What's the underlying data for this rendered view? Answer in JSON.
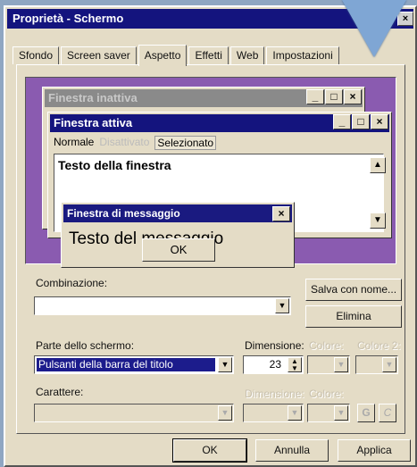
{
  "window": {
    "title": "Proprietà - Schermo",
    "close_glyph": "×"
  },
  "tabs": [
    {
      "label": "Sfondo"
    },
    {
      "label": "Screen saver"
    },
    {
      "label": "Aspetto",
      "active": true
    },
    {
      "label": "Effetti"
    },
    {
      "label": "Web"
    },
    {
      "label": "Impostazioni"
    }
  ],
  "preview": {
    "inactive_title": "Finestra inattiva",
    "active_title": "Finestra attiva",
    "menu_normal": "Normale",
    "menu_disabled": "Disattivato",
    "menu_selected": "Selezionato",
    "window_text": "Testo della finestra",
    "msg_title": "Finestra di messaggio",
    "msg_text": "Testo del messaggio",
    "msg_ok": "OK",
    "cap_min": "_",
    "cap_max": "□",
    "cap_close": "×"
  },
  "form": {
    "scheme_label": "Combinazione:",
    "scheme_value": "",
    "save_as": "Salva con nome...",
    "delete": "Elimina",
    "item_label": "Parte dello schermo:",
    "item_value": "Pulsanti della barra del titolo",
    "size_label": "Dimensione:",
    "size_value": "23",
    "color_label": "Colore:",
    "color2_label": "Colore 2:",
    "font_label": "Carattere:",
    "font_size_label": "Dimensione:",
    "font_color_label": "Colore:",
    "bold": "G",
    "italic": "C"
  },
  "footer": {
    "ok": "OK",
    "cancel": "Annulla",
    "apply": "Applica"
  },
  "colors": {
    "titlebar_active": "#14147e",
    "desktop_preview": "#8a5bb0",
    "dialog_face": "#e4dcc6",
    "decor_triangle": "#7fa6d4"
  }
}
